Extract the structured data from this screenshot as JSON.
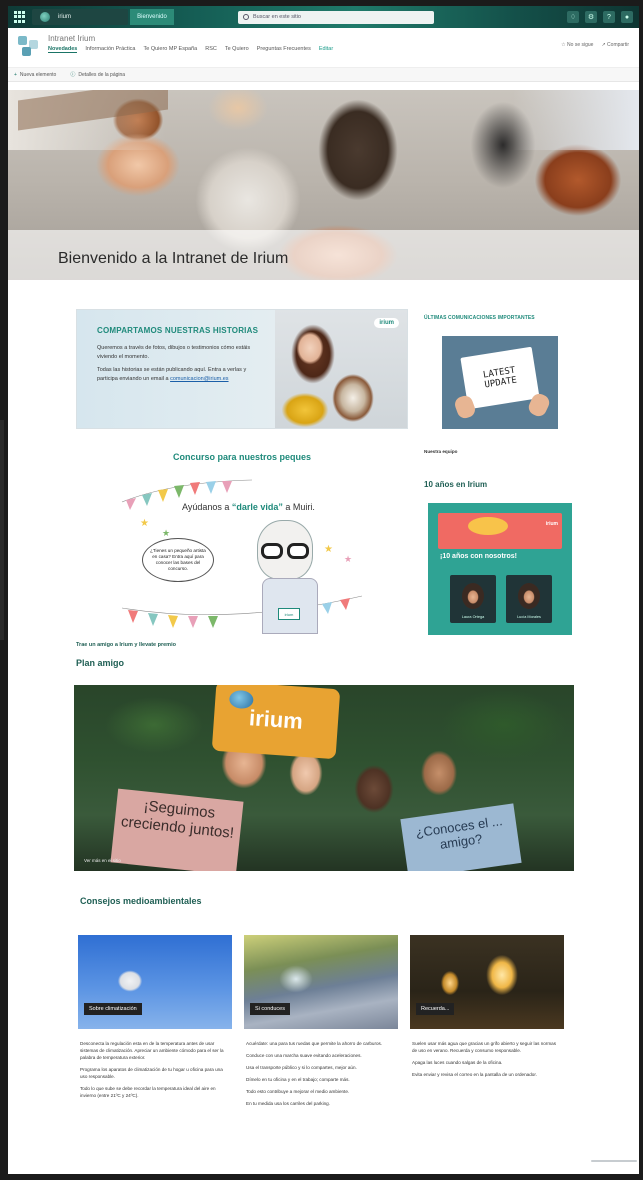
{
  "suite": {
    "brand": "irium",
    "site_pill": "Bienvenido",
    "search_placeholder": "Buscar en este sitio",
    "icons": [
      "bell-icon",
      "gear-icon",
      "help-icon",
      "avatar-icon"
    ]
  },
  "site": {
    "title": "Intranet Irium",
    "nav": [
      "Novedades",
      "Información Práctica",
      "Te Quiero MP España",
      "RSC",
      "Te Quiero",
      "Preguntas Frecuentes",
      "Editar"
    ],
    "follow": "No se sigue",
    "share": "Compartir"
  },
  "command": {
    "new": "Nueva elemento",
    "details": "Detalles de la página"
  },
  "hero": {
    "title": "Bienvenido a la Intranet de Irium"
  },
  "stories": {
    "title": "COMPARTAMOS NUESTRAS HISTORIAS",
    "p1": "Queremos a través de fotos, dibujos o testimonios cómo estáis viviendo el momento.",
    "p2": "Todas las historias se están publicando aquí. Entra a verlas y participa enviando un email a",
    "email": "comunicacion@irium.es",
    "logo": "irium"
  },
  "contest": {
    "title": "Concurso para nuestros peques",
    "text_before": "Ayúdanos a ",
    "text_highlight": "“darle vida”",
    "text_after": " a Muiri.",
    "bubble": "¿Tienes un pequeño artista en casa? Entra aquí para conocer las bases del concurso.",
    "badge": "irium"
  },
  "friend": {
    "link": "Trae un amigo a Irium y llevate premio",
    "title": "Plan amigo",
    "sign_brand": "irium",
    "sign_left": "¡Seguimos creciendo juntos!",
    "sign_right": "¿Conoces el ... amigo?",
    "caption": "Ver más en el sitio"
  },
  "eco": {
    "title": "Consejos medioambientales",
    "cards": [
      {
        "label": "Sobre climatización"
      },
      {
        "label": "Si conduces"
      },
      {
        "label": "Recuerda..."
      }
    ],
    "text1": [
      "Desconecta la regulación esta en de la temperatura antes de usar sistemas de climatización. Apreciar un ambiente cómodo para el ser la palabra de temperatura exterior.",
      "Programa los aparatos de climatización de tu hogar u oficina para una uso responsable.",
      "Todo lo que sube se debe recordar la temperatura ideal del aire en invierno (entre 21ºC y 24ºC)."
    ],
    "text2": [
      "Acuérdate: una para tus ruedas que permite la ahorro de carburos.",
      "Conduce con una marcha suave evitando aceleraciones.",
      "Usa el transporte público y si lo compartes, mejor aún.",
      "Dímelo en tu oficina y en el trabajo; comparte más.",
      "Todo esto contribuye a mejorar el medio ambiente.",
      "En tu medida usa los carriles del parking."
    ],
    "text3": [
      "Suelen usar más agua que gracias un grifo abierto y seguir las normas de uso en verano. Recuerda y consumo responsable.",
      "Apaga las luces cuando salgas de la oficina.",
      "Evita enviar y revisa el correo en la pantalla de un ordenador."
    ]
  },
  "news": {
    "title": "ÚLTIMAS COMUNICACIONES IMPORTANTES",
    "paper": "LATEST UPDATE",
    "caption": "Nuestra equipo"
  },
  "years": {
    "title": "10 años en Irium",
    "headline": "¡10 años con nosotros!",
    "brand": "irium",
    "people": [
      "Laura Ortega",
      "Lucía Morales"
    ]
  }
}
